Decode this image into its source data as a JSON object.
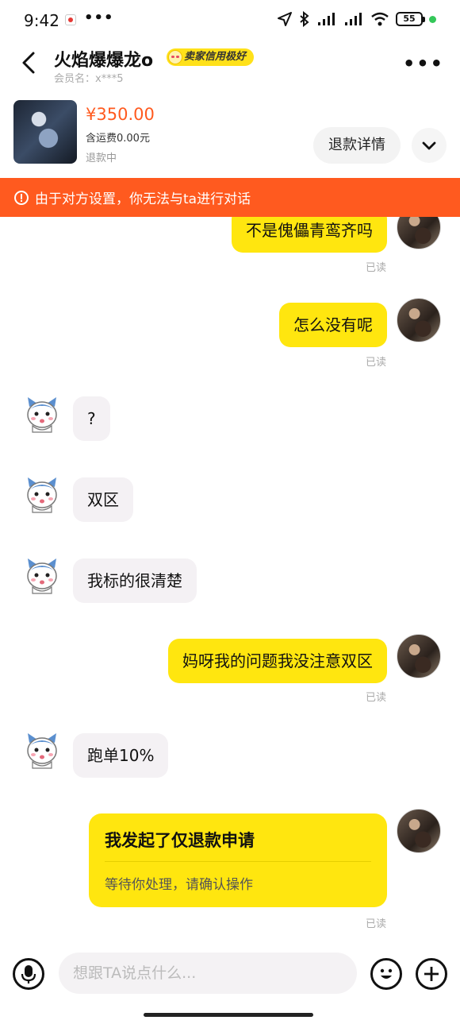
{
  "status_bar": {
    "time": "9:42",
    "more": "•••",
    "battery": "55"
  },
  "header": {
    "shop_name": "火焰爆爆龙o",
    "credit_badge": "卖家信用极好",
    "member": "会员名：x***5"
  },
  "product": {
    "price": "¥350.00",
    "shipping": "含运费0.00元",
    "status": "退款中",
    "detail_button": "退款详情"
  },
  "banner": {
    "text": "由于对方设置，你无法与ta进行对话"
  },
  "messages": {
    "m1": "不是傀儡青鸾齐吗",
    "m2": "怎么没有呢",
    "m3": "?",
    "m4": "双区",
    "m5": "我标的很清楚",
    "m6": "妈呀我的问题我没注意双区",
    "m7": "跑单10%"
  },
  "read_label": "已读",
  "request_card": {
    "title": "我发起了仅退款申请",
    "subtitle": "等待你处理，请确认操作"
  },
  "input": {
    "placeholder": "想跟TA说点什么..."
  },
  "colors": {
    "accent_orange": "#ff5a1f",
    "bubble_yellow": "#ffe60f"
  }
}
